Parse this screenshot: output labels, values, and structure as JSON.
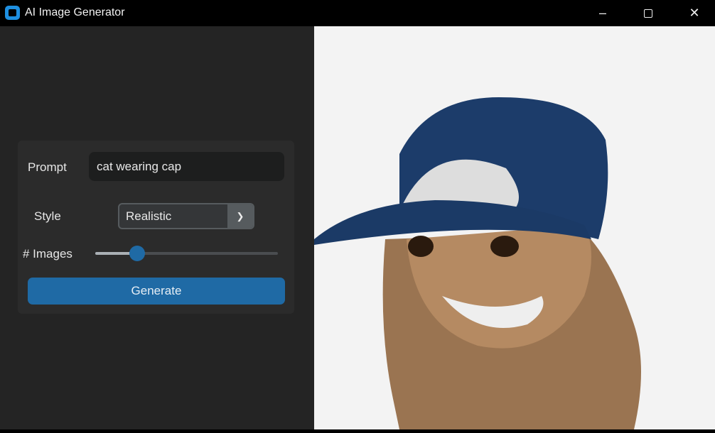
{
  "window": {
    "title": "AI Image Generator",
    "minimize_icon": "minimize-icon",
    "maximize_icon": "maximize-icon",
    "close_icon": "close-icon"
  },
  "form": {
    "prompt_label": "Prompt",
    "prompt_value": "cat wearing cap",
    "style_label": "Style",
    "style_value": "Realistic",
    "images_label": "# Images",
    "images_slider_fraction": 0.23,
    "generate_label": "Generate"
  },
  "colors": {
    "accent": "#1f6aa5",
    "panel": "#242424",
    "frame": "#2b2b2b"
  },
  "output": {
    "image_description_icon": "generated-image"
  }
}
